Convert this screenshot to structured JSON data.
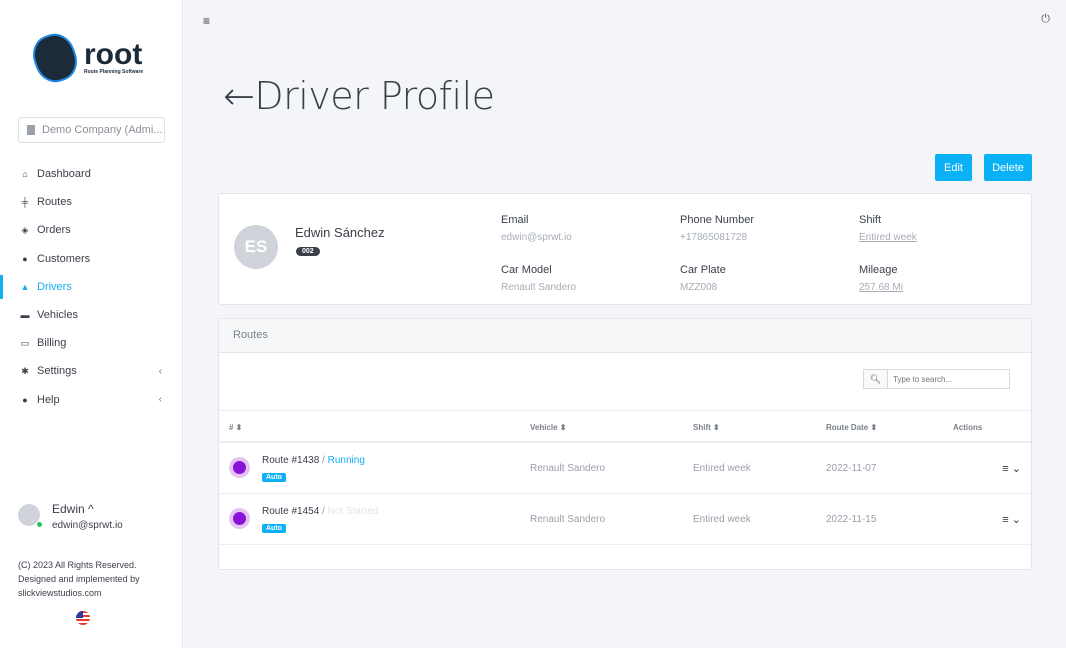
{
  "brand": {
    "name": "root",
    "tagline": "Route Planning Software"
  },
  "company": {
    "label": "Demo Company (Admi..."
  },
  "nav": [
    {
      "label": "Dashboard",
      "icon": "home-icon",
      "glyph": "⌂"
    },
    {
      "label": "Routes",
      "icon": "signpost-icon",
      "glyph": "╪"
    },
    {
      "label": "Orders",
      "icon": "box-icon",
      "glyph": "◈"
    },
    {
      "label": "Customers",
      "icon": "map-pin-icon",
      "glyph": "●"
    },
    {
      "label": "Drivers",
      "icon": "user-icon",
      "glyph": "▲",
      "active": true
    },
    {
      "label": "Vehicles",
      "icon": "car-icon",
      "glyph": "▬"
    },
    {
      "label": "Billing",
      "icon": "money-icon",
      "glyph": "▭"
    },
    {
      "label": "Settings",
      "icon": "gear-icon",
      "glyph": "✱",
      "chevron": "‹"
    },
    {
      "label": "Help",
      "icon": "question-circle-icon",
      "glyph": "●",
      "chevron": "‹"
    }
  ],
  "user": {
    "name": "Edwin",
    "chevron": "^",
    "email": "edwin@sprwt.io",
    "status": "online"
  },
  "footer": {
    "line1": "(C) 2023 All Rights Reserved.",
    "line2": "Designed and implemented by",
    "line3": "slickviewstudios.com"
  },
  "header": {
    "menu_glyph": "≡",
    "power_glyph": "⏻"
  },
  "page": {
    "back_arrow": "←",
    "title": "Driver Profile"
  },
  "actions": {
    "edit": "Edit",
    "delete": "Delete"
  },
  "colors": {
    "accent": "#0ab1f6",
    "route_icon": "#8a12d6"
  },
  "profile": {
    "initials": "ES",
    "name": "Edwin Sánchez",
    "badge": "002",
    "fields": [
      {
        "label": "Email",
        "value": "edwin@sprwt.io"
      },
      {
        "label": "Phone Number",
        "value": "+17865081728"
      },
      {
        "label": "Shift",
        "value": "Entired week",
        "link": true
      },
      {
        "label": "Car Model",
        "value": "Renault Sandero"
      },
      {
        "label": "Car Plate",
        "value": "MZZ008"
      },
      {
        "label": "Mileage",
        "value": "257.68 Mi",
        "link": true
      }
    ]
  },
  "routes": {
    "title": "Routes",
    "search_placeholder": "Type to search...",
    "columns": [
      "# ⬍",
      "Vehicle ⬍",
      "Shift ⬍",
      "Route Date ⬍",
      "Actions"
    ],
    "rows": [
      {
        "name": "Route #1438",
        "sep": " / ",
        "status": "Running",
        "tag": "Auto",
        "vehicle": "Renault Sandero",
        "shift": "Entired week",
        "date": "2022-11-07",
        "actions": "≡ ⌄"
      },
      {
        "name": "Route #1454",
        "sep": " / ",
        "status": "Not Started",
        "tag": "Auto",
        "vehicle": "Renault Sandero",
        "shift": "Entired week",
        "date": "2022-11-15",
        "actions": "≡ ⌄"
      }
    ]
  }
}
